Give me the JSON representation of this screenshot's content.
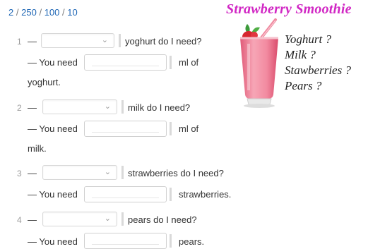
{
  "header": {
    "parts": [
      "2",
      "250",
      "100",
      "10"
    ],
    "separator": "/"
  },
  "illustration": {
    "title": "Strawberry Smoothie",
    "questions": [
      "Yoghurt ?",
      "Milk ?",
      "Stawberries ?",
      "Pears ?"
    ]
  },
  "dash": "—",
  "items": [
    {
      "number": "1",
      "question_text": "yoghurt do I need?",
      "answer_prefix": "— You need",
      "answer_suffix": "ml of",
      "answer_continuation": "yoghurt."
    },
    {
      "number": "2",
      "question_text": "milk do I need?",
      "answer_prefix": "— You need",
      "answer_suffix": "ml of",
      "answer_continuation": "milk."
    },
    {
      "number": "3",
      "question_text": "strawberries do I need?",
      "answer_prefix": "— You need",
      "answer_suffix": "strawberries."
    },
    {
      "number": "4",
      "question_text": "pears do I need?",
      "answer_prefix": "— You need",
      "answer_suffix": "pears."
    }
  ]
}
